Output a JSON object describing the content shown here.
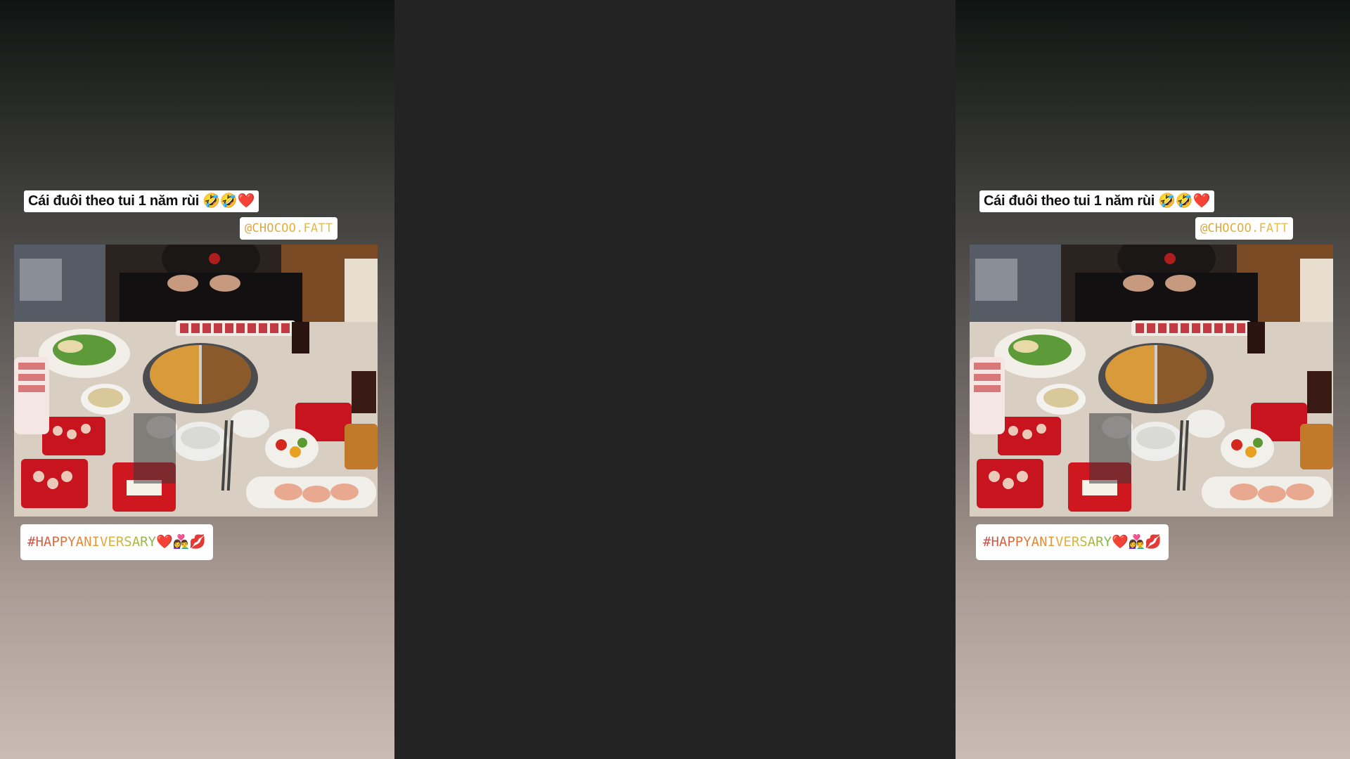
{
  "stories": [
    {
      "caption": "Cái đuôi theo tui 1 năm rùi",
      "caption_emojis": "🤣🤣❤️",
      "mention": "@CHOCOO.FATT",
      "hashtag": "#HAPPYANIVERSARY",
      "hashtag_emojis": "❤️👩‍❤️‍👨💋",
      "photo_subject": "hotpot-dinner-photo"
    },
    {
      "caption": "Cái đuôi theo tui 1 năm rùi",
      "caption_emojis": "🤣🤣❤️",
      "mention": "@CHOCOO.FATT",
      "hashtag": "#HAPPYANIVERSARY",
      "hashtag_emojis": "❤️👩‍❤️‍👨💋",
      "photo_subject": "hotpot-dinner-photo"
    }
  ],
  "colors": {
    "background": "#232323",
    "mention_gradient": [
      "#d9a23a",
      "#e8c04a"
    ],
    "hashtag_gradient": [
      "#c0504d",
      "#e07a3a",
      "#e6b33a",
      "#7bb84a"
    ]
  }
}
